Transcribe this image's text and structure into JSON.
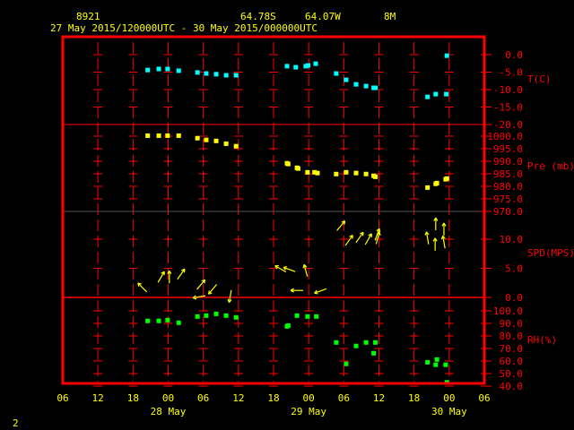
{
  "header": {
    "station_id": "8921",
    "latitude": "64.78S",
    "longitude": "64.07W",
    "elevation": "8M",
    "period": "27 May 2015/120000UTC - 30 May 2015/000000UTC"
  },
  "footer": {
    "page_number": "2"
  },
  "colors": {
    "frame": "#ff0000",
    "text": "#ffff00",
    "temperature": "#00ffff",
    "pressure": "#ffff00",
    "wind": "#ffff00",
    "humidity": "#00ff00",
    "divider": "#555555"
  },
  "chart_data": {
    "type": "scatter",
    "x_unit": "hours since 27 May 06UTC",
    "xlim": [
      0,
      72
    ],
    "x_ticks": [
      {
        "h": 0,
        "label": "06"
      },
      {
        "h": 6,
        "label": "12"
      },
      {
        "h": 12,
        "label": "18"
      },
      {
        "h": 18,
        "label": "00"
      },
      {
        "h": 24,
        "label": "06"
      },
      {
        "h": 30,
        "label": "12"
      },
      {
        "h": 36,
        "label": "18"
      },
      {
        "h": 42,
        "label": "00"
      },
      {
        "h": 48,
        "label": "06"
      },
      {
        "h": 54,
        "label": "12"
      },
      {
        "h": 60,
        "label": "18"
      },
      {
        "h": 66,
        "label": "00"
      },
      {
        "h": 72,
        "label": "06"
      }
    ],
    "date_labels": [
      {
        "h": 18,
        "label": "28 May"
      },
      {
        "h": 42,
        "label": "29 May"
      },
      {
        "h": 66,
        "label": "30 May"
      }
    ],
    "panels": [
      {
        "key": "temperature",
        "label": "T(C)",
        "ylim": [
          -20,
          0
        ],
        "ticks": [
          {
            "v": 0,
            "label": "0.0"
          },
          {
            "v": -5,
            "label": "-5.0"
          },
          {
            "v": -10,
            "label": "-10.0"
          },
          {
            "v": -15,
            "label": "-15.0"
          },
          {
            "v": -20,
            "label": "-20.0"
          }
        ],
        "points": [
          [
            14.5,
            -4.4
          ],
          [
            16.4,
            -4.1
          ],
          [
            17.9,
            -4.1
          ],
          [
            19.8,
            -4.6
          ],
          [
            23,
            -5.1
          ],
          [
            24.5,
            -5.4
          ],
          [
            26.2,
            -5.6
          ],
          [
            27.9,
            -5.9
          ],
          [
            29.6,
            -5.9
          ],
          [
            38.3,
            -3.3
          ],
          [
            39.8,
            -3.6
          ],
          [
            41.5,
            -3.3
          ],
          [
            41.9,
            -3.1
          ],
          [
            43.2,
            -2.6
          ],
          [
            46.7,
            -5.4
          ],
          [
            48.4,
            -7.2
          ],
          [
            50.1,
            -8.5
          ],
          [
            51.8,
            -9.0
          ],
          [
            53.1,
            -9.5
          ],
          [
            53.4,
            -9.5
          ],
          [
            62.3,
            -12.1
          ],
          [
            63.7,
            -11.3
          ],
          [
            65.5,
            -11.3
          ],
          [
            65.6,
            -0.3
          ]
        ]
      },
      {
        "key": "pressure",
        "label": "Pre (mb)",
        "ylim": [
          970,
          1000
        ],
        "ticks": [
          {
            "v": 1000,
            "label": "1000.0"
          },
          {
            "v": 995,
            "label": "995.0"
          },
          {
            "v": 990,
            "label": "990.0"
          },
          {
            "v": 985,
            "label": "985.0"
          },
          {
            "v": 980,
            "label": "980.0"
          },
          {
            "v": 975,
            "label": "975.0"
          },
          {
            "v": 970,
            "label": "970.0"
          }
        ],
        "points": [
          [
            14.5,
            1000.2
          ],
          [
            16.4,
            1000.2
          ],
          [
            17.9,
            1000.2
          ],
          [
            19.8,
            1000.2
          ],
          [
            23,
            999.2
          ],
          [
            24.5,
            998.5
          ],
          [
            26.2,
            998.1
          ],
          [
            27.9,
            997
          ],
          [
            29.6,
            996
          ],
          [
            38.3,
            989.2
          ],
          [
            38.5,
            988.9
          ],
          [
            40,
            987.4
          ],
          [
            40.2,
            987.1
          ],
          [
            41.8,
            985.6
          ],
          [
            43,
            985.6
          ],
          [
            43.5,
            985.3
          ],
          [
            46.7,
            984.9
          ],
          [
            48.4,
            985.6
          ],
          [
            50.1,
            985.3
          ],
          [
            51.8,
            984.9
          ],
          [
            53.1,
            984.2
          ],
          [
            53.4,
            983.8
          ],
          [
            62.3,
            979.5
          ],
          [
            63.7,
            981
          ],
          [
            63.9,
            981.3
          ],
          [
            65.4,
            982.8
          ],
          [
            65.6,
            983.1
          ]
        ]
      },
      {
        "key": "wind",
        "label": "SPD(MPS)",
        "ylim": [
          0,
          12.5
        ],
        "ticks": [
          {
            "v": 10,
            "label": "10.0"
          },
          {
            "v": 5,
            "label": "5.0"
          },
          {
            "v": 0,
            "label": "0.0"
          }
        ],
        "arrows_note": "[hour, speed, arrow direction deg clockwise from up]",
        "arrows": [
          [
            13.6,
            1.7,
            315
          ],
          [
            16.8,
            3.5,
            30
          ],
          [
            18.2,
            3.5,
            0
          ],
          [
            20.2,
            4,
            35
          ],
          [
            23.6,
            2.2,
            40
          ],
          [
            25.6,
            1.4,
            220
          ],
          [
            23.3,
            0.1,
            260
          ],
          [
            28.6,
            0.2,
            190
          ],
          [
            37.2,
            4.9,
            300
          ],
          [
            38.7,
            4.8,
            290
          ],
          [
            41.5,
            4.6,
            345
          ],
          [
            40,
            1.2,
            270
          ],
          [
            44,
            1.1,
            250
          ],
          [
            47.5,
            12.3,
            40
          ],
          [
            48.9,
            9.8,
            35
          ],
          [
            50.7,
            10.3,
            35
          ],
          [
            52.2,
            10,
            30
          ],
          [
            53.7,
            10.8,
            20
          ],
          [
            53.8,
            10.2,
            15
          ],
          [
            62.3,
            10.2,
            350
          ],
          [
            63.7,
            12.6,
            0
          ],
          [
            63.6,
            9.1,
            0
          ],
          [
            65.1,
            11.7,
            0
          ],
          [
            65.1,
            9.5,
            350
          ]
        ]
      },
      {
        "key": "humidity",
        "label": "RH(%)",
        "ylim": [
          40,
          100
        ],
        "ticks": [
          {
            "v": 100,
            "label": "100.0"
          },
          {
            "v": 90,
            "label": "90.0"
          },
          {
            "v": 80,
            "label": "80.0"
          },
          {
            "v": 70,
            "label": "70.0"
          },
          {
            "v": 60,
            "label": "60.0"
          },
          {
            "v": 50,
            "label": "50.0"
          },
          {
            "v": 40,
            "label": "40.0"
          }
        ],
        "points": [
          [
            14.5,
            92
          ],
          [
            16.4,
            92
          ],
          [
            17.9,
            92.6
          ],
          [
            19.8,
            90.5
          ],
          [
            23,
            95.5
          ],
          [
            24.5,
            96.2
          ],
          [
            26.2,
            97.6
          ],
          [
            27.9,
            96.2
          ],
          [
            29.6,
            94.8
          ],
          [
            38.3,
            87.6
          ],
          [
            38.5,
            88.3
          ],
          [
            40,
            96.2
          ],
          [
            41.8,
            95.5
          ],
          [
            43.3,
            95.5
          ],
          [
            46.7,
            74.8
          ],
          [
            48.4,
            57.7
          ],
          [
            50.1,
            72
          ],
          [
            51.8,
            74.8
          ],
          [
            53.4,
            74.8
          ],
          [
            53.1,
            66.2
          ],
          [
            62.3,
            59
          ],
          [
            63.9,
            61.2
          ],
          [
            63.7,
            57
          ],
          [
            65.4,
            57
          ],
          [
            65.6,
            43
          ]
        ]
      }
    ]
  }
}
